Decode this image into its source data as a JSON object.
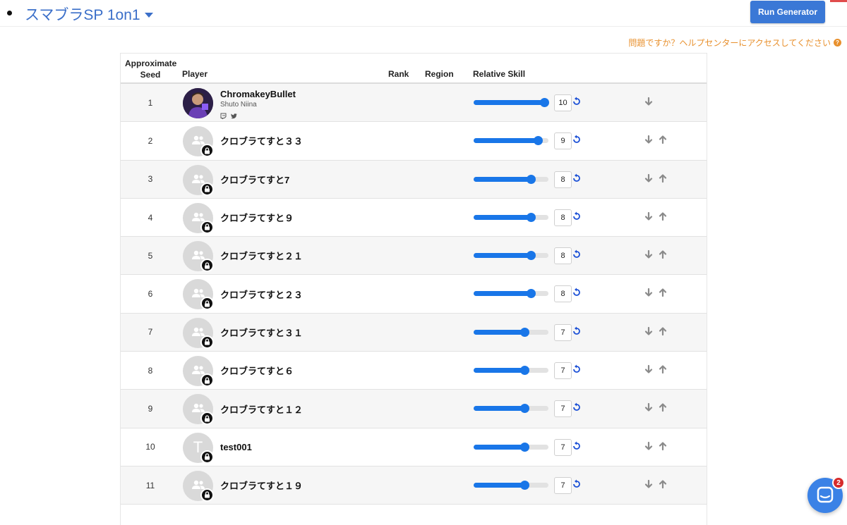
{
  "header": {
    "event_title": "スマブラSP 1on1",
    "run_button": "Run Generator",
    "help_text": "問題ですか？ヘルプセンターにアクセスしてください",
    "help_icon_glyph": "?"
  },
  "table": {
    "columns": {
      "seed_line1": "Approximate",
      "seed_line2": "Seed",
      "player": "Player",
      "rank": "Rank",
      "region": "Region",
      "skill": "Relative Skill"
    },
    "skill_max": 10,
    "rows": [
      {
        "seed": "1",
        "name": "ChromakeyBullet",
        "subname": "Shuto Niina",
        "skill": "10",
        "skill_value": 10,
        "avatar": "photo",
        "up": false
      },
      {
        "seed": "2",
        "name": "クロブラてすと３３",
        "skill": "9",
        "skill_value": 9,
        "avatar": "people",
        "up": true
      },
      {
        "seed": "3",
        "name": "クロブラてすと7",
        "skill": "8",
        "skill_value": 8,
        "avatar": "people",
        "up": true
      },
      {
        "seed": "4",
        "name": "クロブラてすと９",
        "skill": "8",
        "skill_value": 8,
        "avatar": "people",
        "up": true
      },
      {
        "seed": "5",
        "name": "クロブラてすと２１",
        "skill": "8",
        "skill_value": 8,
        "avatar": "people",
        "up": true
      },
      {
        "seed": "6",
        "name": "クロブラてすと２３",
        "skill": "8",
        "skill_value": 8,
        "avatar": "people",
        "up": true
      },
      {
        "seed": "7",
        "name": "クロブラてすと３１",
        "skill": "7",
        "skill_value": 7,
        "avatar": "people",
        "up": true
      },
      {
        "seed": "8",
        "name": "クロブラてすと６",
        "skill": "7",
        "skill_value": 7,
        "avatar": "people",
        "up": true
      },
      {
        "seed": "9",
        "name": "クロブラてすと１２",
        "skill": "7",
        "skill_value": 7,
        "avatar": "people",
        "up": true
      },
      {
        "seed": "10",
        "name": "test001",
        "skill": "7",
        "skill_value": 7,
        "avatar": "letter",
        "letter": "T",
        "up": true
      },
      {
        "seed": "11",
        "name": "クロブラてすと１９",
        "skill": "7",
        "skill_value": 7,
        "avatar": "people",
        "up": true
      }
    ]
  },
  "chat": {
    "badge": "2"
  },
  "colors": {
    "accent": "#1976e8",
    "title": "#3b6fc9",
    "button": "#3a78d6",
    "help": "#e8902d",
    "badge": "#d62b2b"
  }
}
